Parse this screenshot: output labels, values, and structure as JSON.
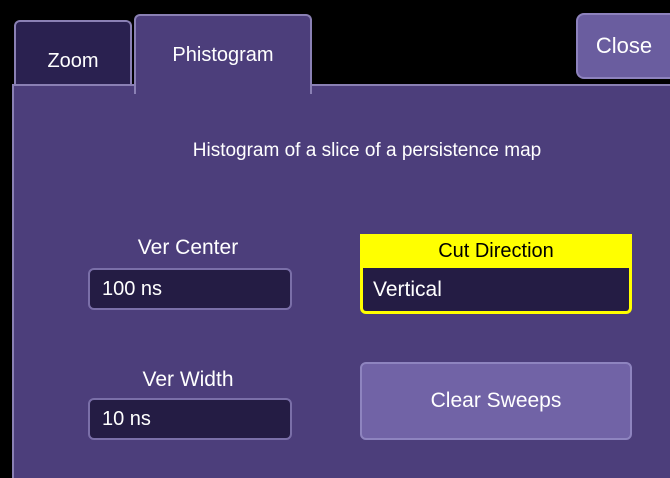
{
  "tabs": [
    {
      "label": "Zoom"
    },
    {
      "label": "Phistogram"
    }
  ],
  "close_label": "Close",
  "panel": {
    "subtitle": "Histogram of a slice of a persistence map",
    "ver_center": {
      "label": "Ver Center",
      "value": "100 ns"
    },
    "ver_width": {
      "label": "Ver Width",
      "value": "10 ns"
    },
    "cut_direction": {
      "label": "Cut Direction",
      "value": "Vertical"
    },
    "clear_sweeps_label": "Clear Sweeps"
  },
  "colors": {
    "panel_bg": "#4c3e7b",
    "inactive_tab_bg": "#2a2150",
    "field_bg": "#241c44",
    "highlight": "#ffff00",
    "button_bg": "#7163a6"
  }
}
